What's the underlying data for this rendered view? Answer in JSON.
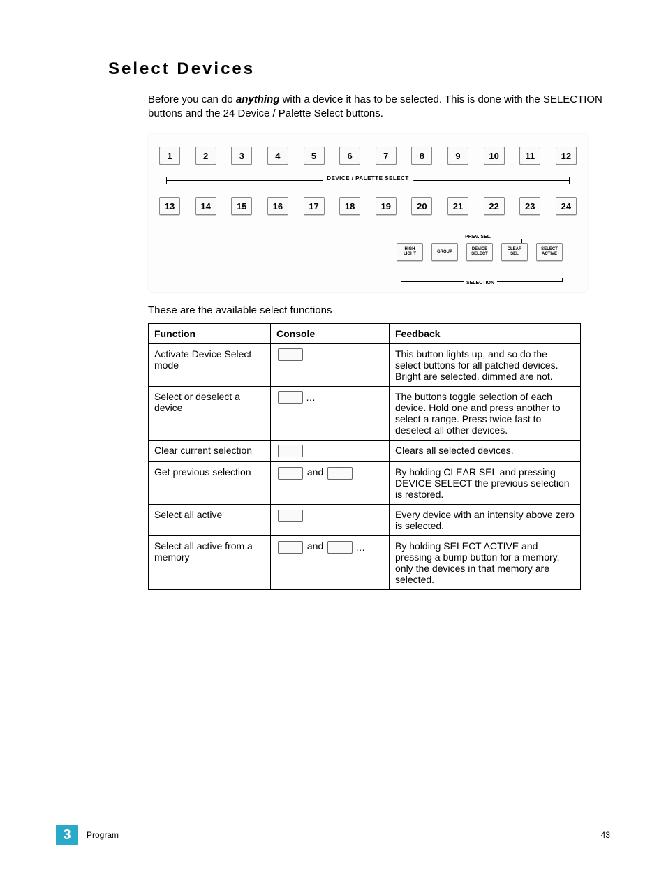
{
  "title": "Select Devices",
  "intro_before": "Before you can do ",
  "intro_em": "anything",
  "intro_after": " with a device it has to be selected. This is done with the SELECTION buttons and the 24 Device / Palette Select buttons.",
  "buttons_row1": [
    "1",
    "2",
    "3",
    "4",
    "5",
    "6",
    "7",
    "8",
    "9",
    "10",
    "11",
    "12"
  ],
  "buttons_row2": [
    "13",
    "14",
    "15",
    "16",
    "17",
    "18",
    "19",
    "20",
    "21",
    "22",
    "23",
    "24"
  ],
  "bracket_label": "DEVICE / PALETTE SELECT",
  "prev_sel": "PREV. SEL.",
  "selection_label": "SELECTION",
  "sel_keys": [
    "HIGH\nLIGHT",
    "GROUP",
    "DEVICE\nSELECT",
    "CLEAR\nSEL",
    "SELECT\nACTIVE"
  ],
  "subtext": "These are the available select functions",
  "table": {
    "headers": [
      "Function",
      "Console",
      "Feedback"
    ],
    "rows": [
      {
        "function": "Activate Device Select mode",
        "console_type": "single",
        "feedback": "This button lights up, and so do the select buttons for all patched devices. Bright are selected, dimmed are not."
      },
      {
        "function": "Select or deselect a device",
        "console_type": "single_dots",
        "feedback": "The buttons toggle selection of each device. Hold one and press another to select a range. Press twice fast to deselect all other devices."
      },
      {
        "function": "Clear current selection",
        "console_type": "single",
        "feedback": "Clears all selected devices."
      },
      {
        "function": "Get previous selection",
        "console_type": "and",
        "feedback": "By holding CLEAR SEL and pressing DEVICE SELECT the previous selection is restored."
      },
      {
        "function": "Select all active",
        "console_type": "single",
        "feedback": "Every device with an intensity above zero is selected."
      },
      {
        "function": "Select all active from a memory",
        "console_type": "and_dots",
        "feedback": "By holding SELECT ACTIVE and pressing a bump button for a memory, only the devices in that memory are selected."
      }
    ]
  },
  "and_label": "and",
  "ellipsis": "…",
  "footer": {
    "chapter_num": "3",
    "chapter_name": "Program",
    "page": "43"
  }
}
